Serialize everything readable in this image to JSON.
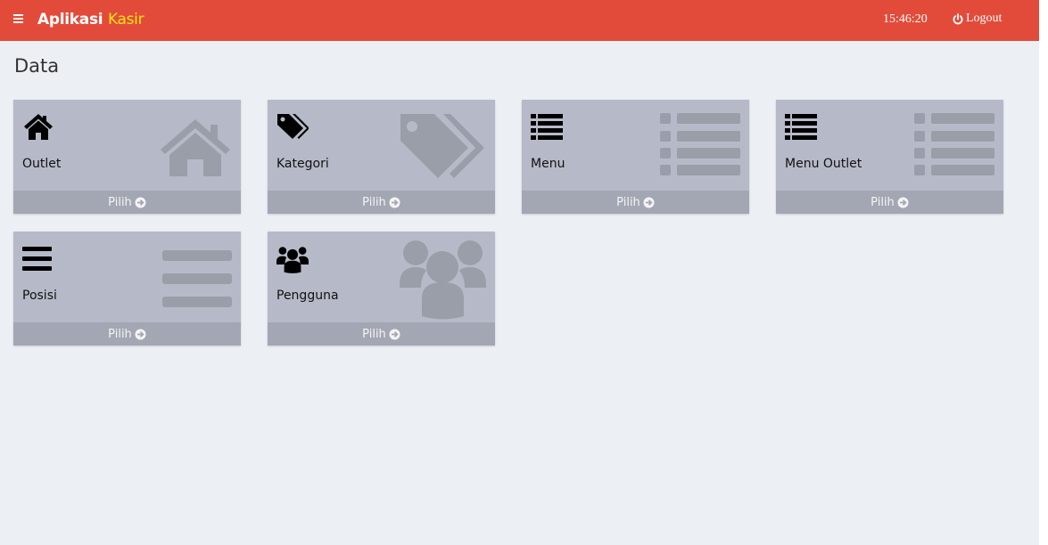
{
  "header": {
    "brand_main": "Aplikasi",
    "brand_accent": "Kasir",
    "time": "15:46:20",
    "logout_label": "Logout"
  },
  "page": {
    "title": "Data"
  },
  "colors": {
    "header": "#e24b3a",
    "brand_accent": "#ffe31a",
    "tile": "#b6bac8",
    "tile_footer": "#a3a7b3",
    "background": "#eceff4"
  },
  "tiles": [
    {
      "label": "Outlet",
      "action": "Pilih",
      "icon": "home-icon"
    },
    {
      "label": "Kategori",
      "action": "Pilih",
      "icon": "tags-icon"
    },
    {
      "label": "Menu",
      "action": "Pilih",
      "icon": "list-icon"
    },
    {
      "label": "Menu Outlet",
      "action": "Pilih",
      "icon": "list-icon"
    },
    {
      "label": "Posisi",
      "action": "Pilih",
      "icon": "bars-icon"
    },
    {
      "label": "Pengguna",
      "action": "Pilih",
      "icon": "users-icon"
    }
  ]
}
